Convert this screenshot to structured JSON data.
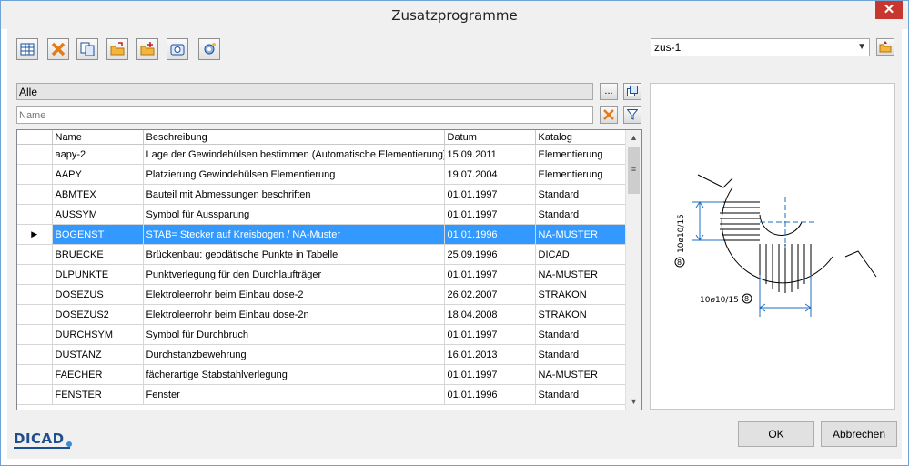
{
  "window": {
    "title": "Zusatzprogramme",
    "close_glyph": "✕"
  },
  "toolbar": {
    "icons": [
      "table-icon",
      "delete-x-icon",
      "copy-icon",
      "folder-import-icon",
      "folder-add-icon",
      "camera-icon",
      "settings-gear-icon"
    ]
  },
  "catalog_select": {
    "value": "zus-1"
  },
  "filter": {
    "value": "Alle",
    "browse_label": "..."
  },
  "name_input": {
    "placeholder": "Name"
  },
  "table": {
    "headers": [
      "Name",
      "Beschreibung",
      "Datum",
      "Katalog"
    ],
    "rows": [
      [
        "aapy-2",
        "Lage der Gewindehülsen bestimmen (Automatische Elementierung)",
        "15.09.2011",
        "Elementierung"
      ],
      [
        "AAPY",
        "Platzierung Gewindehülsen Elementierung",
        "19.07.2004",
        "Elementierung"
      ],
      [
        "ABMTEX",
        "Bauteil mit Abmessungen beschriften",
        "01.01.1997",
        "Standard"
      ],
      [
        "AUSSYM",
        "Symbol für Aussparung",
        "01.01.1997",
        "Standard"
      ],
      [
        "BOGENST",
        "STAB= Stecker auf Kreisbogen / NA-Muster",
        "01.01.1996",
        "NA-MUSTER"
      ],
      [
        "BRUECKE",
        "Brückenbau: geodätische Punkte in Tabelle",
        "25.09.1996",
        "DICAD"
      ],
      [
        "DLPUNKTE",
        "Punktverlegung für den Durchlaufträger",
        "01.01.1997",
        "NA-MUSTER"
      ],
      [
        "DOSEZUS",
        "Elektroleerrohr beim Einbau dose-2",
        "26.02.2007",
        "STRAKON"
      ],
      [
        "DOSEZUS2",
        "Elektroleerrohr beim Einbau dose-2n",
        "18.04.2008",
        "STRAKON"
      ],
      [
        "DURCHSYM",
        "Symbol für Durchbruch",
        "01.01.1997",
        "Standard"
      ],
      [
        "DUSTANZ",
        "Durchstanzbewehrung",
        "16.01.2013",
        "Standard"
      ],
      [
        "FAECHER",
        "fächerartige Stabstahlverlegung",
        "01.01.1997",
        "NA-MUSTER"
      ],
      [
        "FENSTER",
        "Fenster",
        "01.01.1996",
        "Standard"
      ]
    ],
    "selected_index": 4
  },
  "preview": {
    "label_vertical": "10ø10/15",
    "label_horizontal": "10ø10/15",
    "marker": "8"
  },
  "logo": "DICAD",
  "buttons": {
    "ok": "OK",
    "cancel": "Abbrechen"
  },
  "colors": {
    "selection": "#3399ff",
    "close": "#c7372f",
    "logo": "#1f4e8c"
  }
}
